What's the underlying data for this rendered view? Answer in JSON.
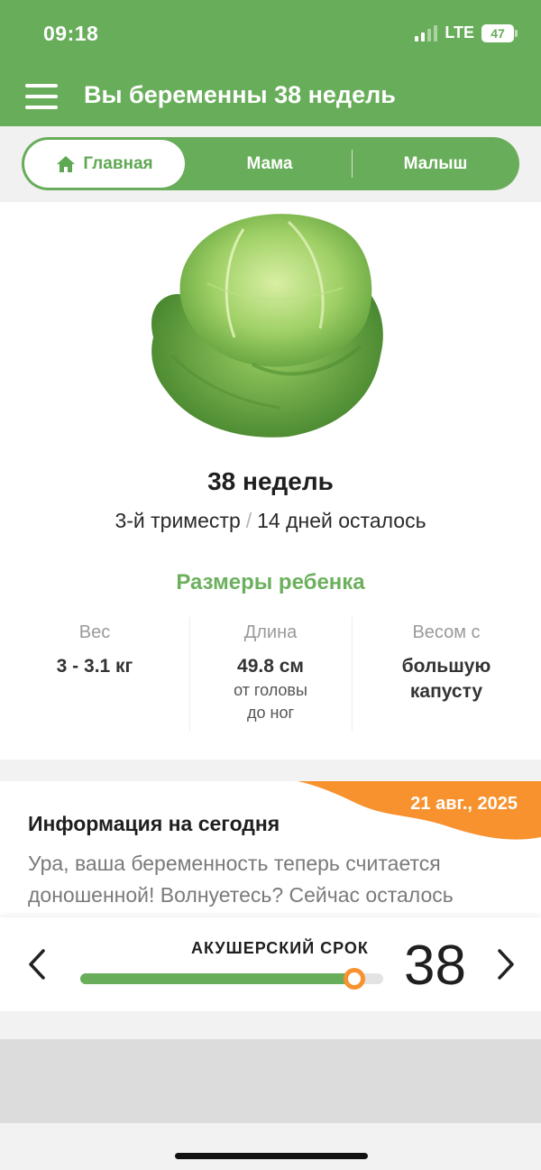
{
  "status_bar": {
    "time": "09:18",
    "network": "LTE",
    "battery": "47"
  },
  "header": {
    "title": "Вы беременны 38 недель"
  },
  "tabs": [
    {
      "label": "Главная",
      "active": true
    },
    {
      "label": "Мама",
      "active": false
    },
    {
      "label": "Малыш",
      "active": false
    }
  ],
  "week": {
    "title": "38 недель",
    "trimester": "3-й триместр",
    "separator": "/",
    "days_left": "14 дней осталось",
    "image_icon": "cabbage-image"
  },
  "sizes": {
    "title": "Размеры ребенка",
    "weight": {
      "label": "Вес",
      "value": "3 - 3.1 кг"
    },
    "length": {
      "label": "Длина",
      "value": "49.8 см",
      "note_line1": "от головы",
      "note_line2": "до ног"
    },
    "compare": {
      "label": "Весом с",
      "value_line1": "большую",
      "value_line2": "капусту"
    }
  },
  "info": {
    "date": "21 авг., 2025",
    "title": "Информация на сегодня",
    "text": "Ура, ваша беременность теперь считается доношенной! Волнуетесь? Сейчас осталось"
  },
  "term_bar": {
    "label": "АКУШЕРСКИЙ СРОК",
    "week_number": "38",
    "progress_fraction": 0.905
  },
  "colors": {
    "brand_green": "#68ad5a",
    "accent_orange": "#f7922e",
    "title_green": "#6cb05e"
  }
}
